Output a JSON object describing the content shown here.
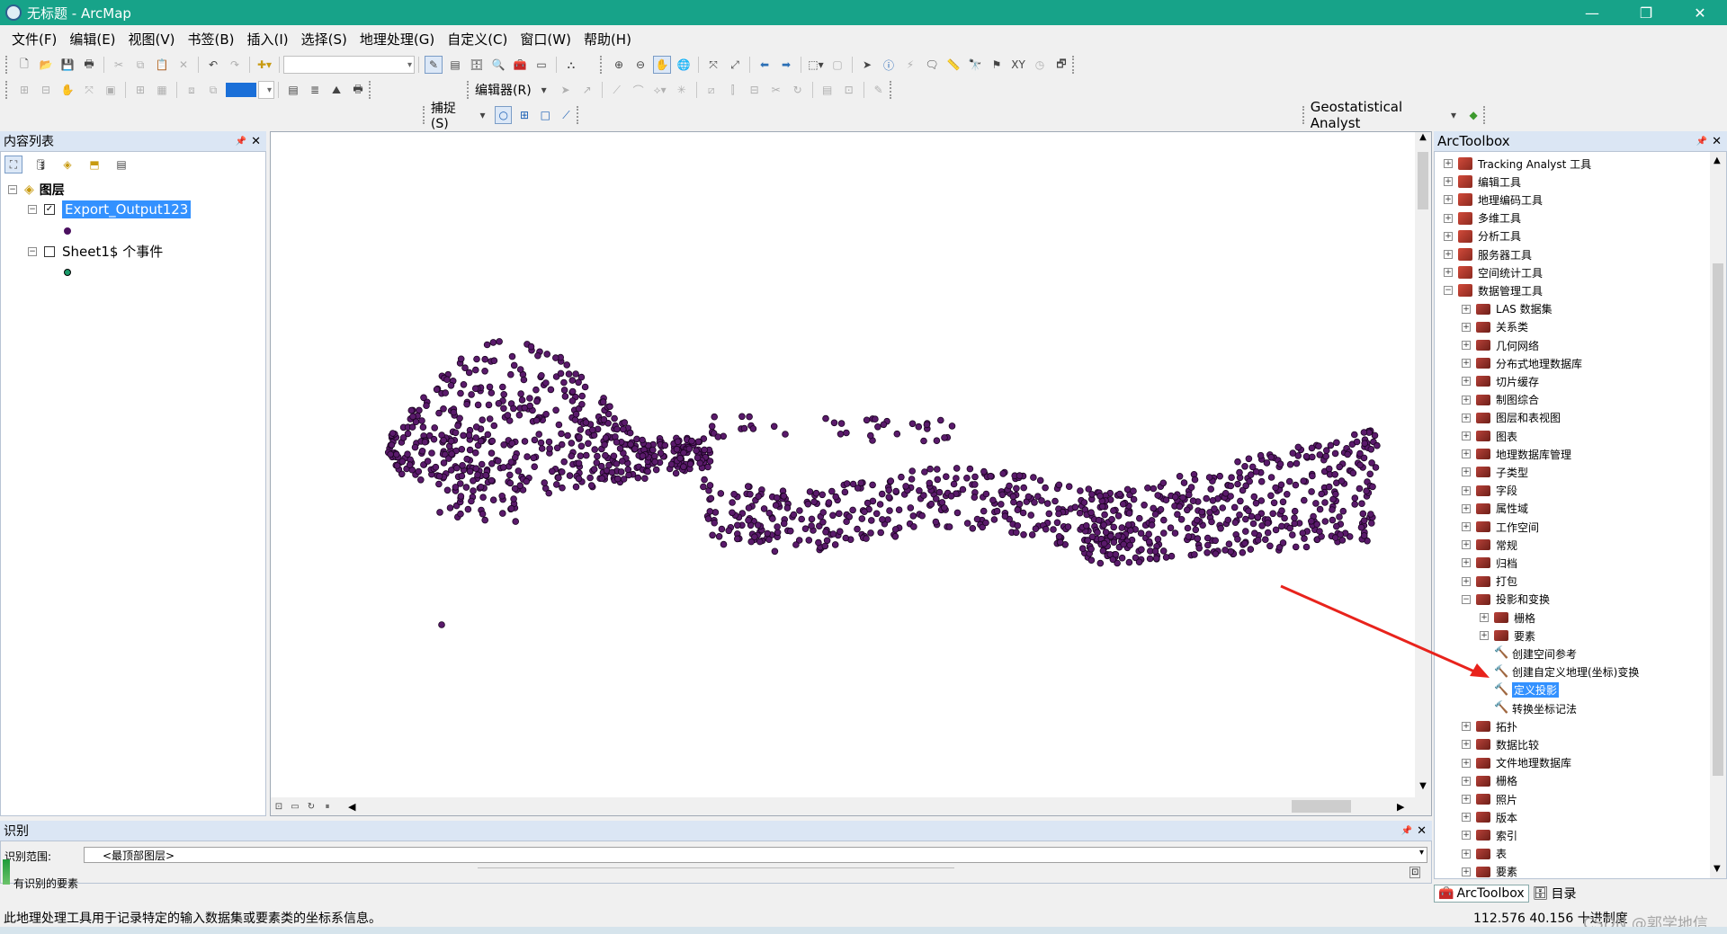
{
  "window": {
    "title": "无标题 - ArcMap",
    "controls": [
      "—",
      "❐",
      "✕"
    ]
  },
  "menu": [
    "文件(F)",
    "编辑(E)",
    "视图(V)",
    "书签(B)",
    "插入(I)",
    "选择(S)",
    "地理处理(G)",
    "自定义(C)",
    "窗口(W)",
    "帮助(H)"
  ],
  "toolbars": {
    "editor_label": "编辑器(R)",
    "snapping_label": "捕捉(S)",
    "geostat_label": "Geostatistical Analyst"
  },
  "toc": {
    "title": "内容列表",
    "root": "图层",
    "layers": [
      {
        "name": "Export_Output123",
        "checked": true,
        "selected": true,
        "symbol_color": "#4b1060"
      },
      {
        "name": "Sheet1$ 个事件",
        "checked": false,
        "selected": false,
        "symbol_color": "#1a9a6a"
      }
    ]
  },
  "map": {
    "point_color": "#5a1a6b",
    "scroll_buttons": [
      "▲",
      "▼",
      "◀",
      "▶"
    ]
  },
  "arctoolbox": {
    "title": "ArcToolbox",
    "items": [
      {
        "label": "Tracking Analyst 工具",
        "level": 0,
        "kind": "toolbox",
        "expanded": false
      },
      {
        "label": "编辑工具",
        "level": 0,
        "kind": "toolbox",
        "expanded": false
      },
      {
        "label": "地理编码工具",
        "level": 0,
        "kind": "toolbox",
        "expanded": false
      },
      {
        "label": "多维工具",
        "level": 0,
        "kind": "toolbox",
        "expanded": false
      },
      {
        "label": "分析工具",
        "level": 0,
        "kind": "toolbox",
        "expanded": false
      },
      {
        "label": "服务器工具",
        "level": 0,
        "kind": "toolbox",
        "expanded": false
      },
      {
        "label": "空间统计工具",
        "level": 0,
        "kind": "toolbox",
        "expanded": false
      },
      {
        "label": "数据管理工具",
        "level": 0,
        "kind": "toolbox",
        "expanded": true
      },
      {
        "label": "LAS 数据集",
        "level": 1,
        "kind": "toolset",
        "expanded": false
      },
      {
        "label": "关系类",
        "level": 1,
        "kind": "toolset",
        "expanded": false
      },
      {
        "label": "几何网络",
        "level": 1,
        "kind": "toolset",
        "expanded": false
      },
      {
        "label": "分布式地理数据库",
        "level": 1,
        "kind": "toolset",
        "expanded": false
      },
      {
        "label": "切片缓存",
        "level": 1,
        "kind": "toolset",
        "expanded": false
      },
      {
        "label": "制图综合",
        "level": 1,
        "kind": "toolset",
        "expanded": false
      },
      {
        "label": "图层和表视图",
        "level": 1,
        "kind": "toolset",
        "expanded": false
      },
      {
        "label": "图表",
        "level": 1,
        "kind": "toolset",
        "expanded": false
      },
      {
        "label": "地理数据库管理",
        "level": 1,
        "kind": "toolset",
        "expanded": false
      },
      {
        "label": "子类型",
        "level": 1,
        "kind": "toolset",
        "expanded": false
      },
      {
        "label": "字段",
        "level": 1,
        "kind": "toolset",
        "expanded": false
      },
      {
        "label": "属性域",
        "level": 1,
        "kind": "toolset",
        "expanded": false
      },
      {
        "label": "工作空间",
        "level": 1,
        "kind": "toolset",
        "expanded": false
      },
      {
        "label": "常规",
        "level": 1,
        "kind": "toolset",
        "expanded": false
      },
      {
        "label": "归档",
        "level": 1,
        "kind": "toolset",
        "expanded": false
      },
      {
        "label": "打包",
        "level": 1,
        "kind": "toolset",
        "expanded": false
      },
      {
        "label": "投影和变换",
        "level": 1,
        "kind": "toolset",
        "expanded": true
      },
      {
        "label": "栅格",
        "level": 2,
        "kind": "toolset",
        "expanded": false
      },
      {
        "label": "要素",
        "level": 2,
        "kind": "toolset",
        "expanded": false
      },
      {
        "label": "创建空间参考",
        "level": 2,
        "kind": "tool"
      },
      {
        "label": "创建自定义地理(坐标)变换",
        "level": 2,
        "kind": "tool"
      },
      {
        "label": "定义投影",
        "level": 2,
        "kind": "tool",
        "selected": true
      },
      {
        "label": "转换坐标记法",
        "level": 2,
        "kind": "tool"
      },
      {
        "label": "拓扑",
        "level": 1,
        "kind": "toolset",
        "expanded": false
      },
      {
        "label": "数据比较",
        "level": 1,
        "kind": "toolset",
        "expanded": false
      },
      {
        "label": "文件地理数据库",
        "level": 1,
        "kind": "toolset",
        "expanded": false
      },
      {
        "label": "栅格",
        "level": 1,
        "kind": "toolset",
        "expanded": false
      },
      {
        "label": "照片",
        "level": 1,
        "kind": "toolset",
        "expanded": false
      },
      {
        "label": "版本",
        "level": 1,
        "kind": "toolset",
        "expanded": false
      },
      {
        "label": "索引",
        "level": 1,
        "kind": "toolset",
        "expanded": false
      },
      {
        "label": "表",
        "level": 1,
        "kind": "toolset",
        "expanded": false
      },
      {
        "label": "要素",
        "level": 1,
        "kind": "toolset",
        "expanded": false
      }
    ],
    "tabs": [
      "ArcToolbox",
      "目录"
    ]
  },
  "identify": {
    "title": "识别",
    "range_label": "识别范围:",
    "range_value": "<最顶部图层>",
    "result_text": "有识别的要素"
  },
  "status": {
    "message": "此地理处理工具用于记录特定的输入数据集或要素类的坐标系信息。",
    "coordinates": "112.576  40.156 十进制度",
    "watermark": "CSDN @郭学地信"
  },
  "annotation": {
    "arrow_color": "#e8231c"
  }
}
